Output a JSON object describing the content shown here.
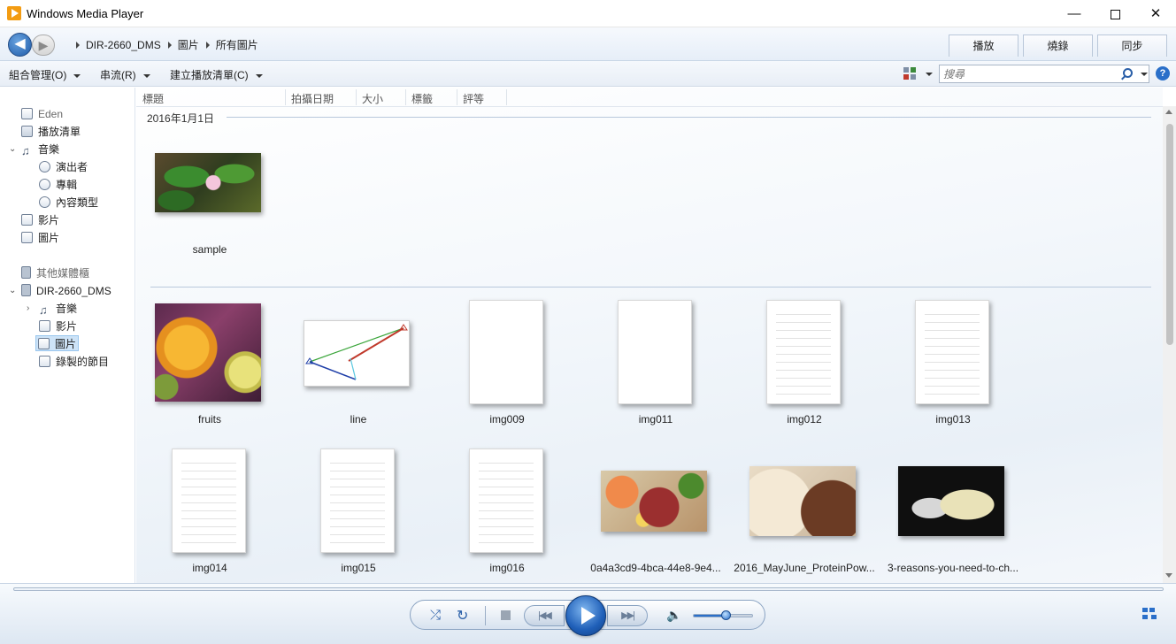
{
  "window": {
    "title": "Windows Media Player",
    "min_label": "—",
    "close_label": "✕"
  },
  "nav": {
    "back_label": "◀",
    "forward_label": "▶",
    "breadcrumb": [
      "DIR-2660_DMS",
      "圖片",
      "所有圖片"
    ]
  },
  "tabs": [
    {
      "label": "播放"
    },
    {
      "label": "燒錄"
    },
    {
      "label": "同步"
    }
  ],
  "commands": {
    "organize": "組合管理(O)",
    "stream": "串流(R)",
    "create_playlist": "建立播放清單(C)"
  },
  "search": {
    "placeholder": "搜尋",
    "help_label": "?"
  },
  "sidebar": {
    "items": [
      {
        "label": "Eden",
        "icon": "library-icon"
      },
      {
        "label": "播放清單",
        "icon": "playlist-icon"
      },
      {
        "label": "音樂",
        "icon": "music-icon",
        "expanded": true
      },
      {
        "label": "演出者",
        "icon": "artist-icon"
      },
      {
        "label": "專輯",
        "icon": "album-icon"
      },
      {
        "label": "內容類型",
        "icon": "genre-icon"
      },
      {
        "label": "影片",
        "icon": "video-icon"
      },
      {
        "label": "圖片",
        "icon": "picture-icon"
      },
      {
        "label": "其他媒體櫃",
        "icon": "other-libraries-icon"
      },
      {
        "label": "DIR-2660_DMS",
        "icon": "device-icon",
        "expanded": true
      },
      {
        "label": "音樂",
        "icon": "music-icon",
        "expanded": false
      },
      {
        "label": "影片",
        "icon": "video-icon"
      },
      {
        "label": "圖片",
        "icon": "picture-icon",
        "selected": true
      },
      {
        "label": "錄製的節目",
        "icon": "recorded-tv-icon"
      }
    ],
    "expand_open": "⌄",
    "expand_closed": "›"
  },
  "columns": [
    "標題",
    "拍攝日期",
    "大小",
    "標籤",
    "評等"
  ],
  "groups": [
    {
      "heading": "2016年1月1日",
      "items": [
        {
          "label": "sample",
          "art": "sample"
        }
      ]
    },
    {
      "heading": "",
      "items": [
        {
          "label": "fruits",
          "art": "fruits"
        },
        {
          "label": "line",
          "art": "line"
        },
        {
          "label": "img009",
          "art": "doc"
        },
        {
          "label": "img011",
          "art": "doc"
        },
        {
          "label": "img012",
          "art": "doc"
        },
        {
          "label": "img013",
          "art": "doc"
        },
        {
          "label": "img014",
          "art": "doc"
        },
        {
          "label": "img015",
          "art": "doc"
        },
        {
          "label": "img016",
          "art": "doc"
        },
        {
          "label": "0a4a3cd9-4bca-44e8-9e4...",
          "art": "food"
        },
        {
          "label": "2016_MayJune_ProteinPow...",
          "art": "protein"
        },
        {
          "label": "3-reasons-you-need-to-ch...",
          "art": "muscle"
        }
      ]
    }
  ],
  "player": {
    "shuffle_label": "⤮",
    "repeat_label": "↻",
    "prev_label": "|◀◀",
    "next_label": "▶▶|",
    "volume_label": "🔈",
    "volume_level": 0.55
  }
}
